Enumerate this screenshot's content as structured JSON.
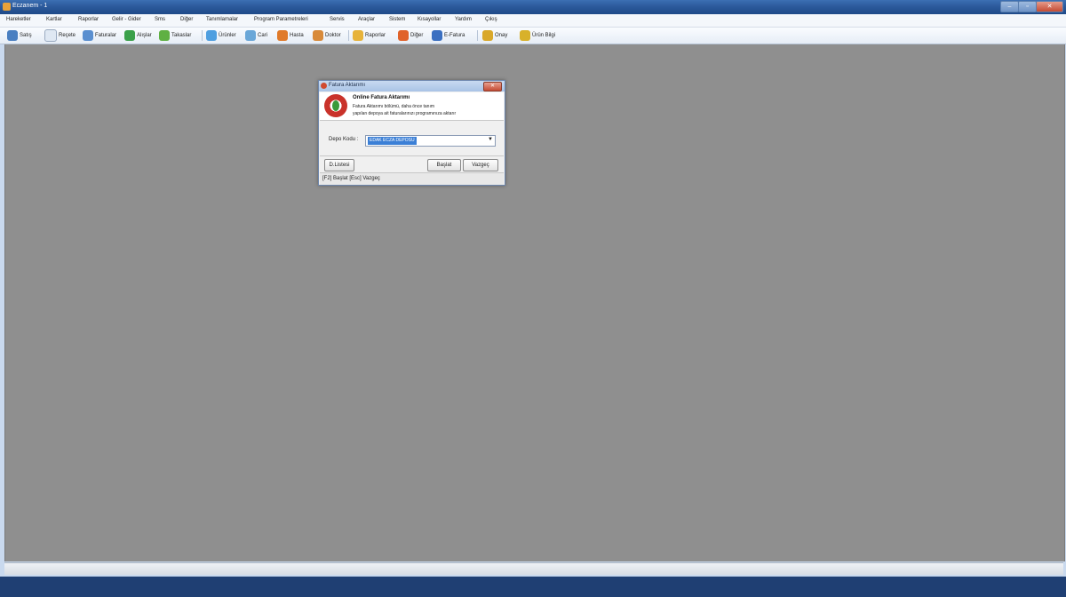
{
  "window": {
    "title": "Eczanem - 1"
  },
  "menu": [
    "Hareketler",
    "Kartlar",
    "Raporlar",
    "Gelir - Gider",
    "Sms",
    "Diğer",
    "Tanımlamalar",
    "Program Parametreleri",
    "Servis",
    "Araçlar",
    "Sistem",
    "Kısayollar",
    "Yardım",
    "Çıkış"
  ],
  "toolbar": [
    {
      "label": "Satış",
      "icon": "cart-icon",
      "color": "#4a7fc1"
    },
    {
      "label": "Reçete",
      "icon": "document-icon",
      "color": "#dfe8f3"
    },
    {
      "label": "Faturalar",
      "icon": "truck-icon",
      "color": "#5a8fd0"
    },
    {
      "label": "Alışlar",
      "icon": "shield-check-icon",
      "color": "#3aa04a"
    },
    {
      "label": "Takaslar",
      "icon": "swap-arrows-icon",
      "color": "#5fb043"
    },
    {
      "label": "Ürünler",
      "icon": "flask-icon",
      "color": "#4f9fe0"
    },
    {
      "label": "Cari",
      "icon": "people-icon",
      "color": "#6aa7d8"
    },
    {
      "label": "Hasta",
      "icon": "patient-icon",
      "color": "#e07a2a"
    },
    {
      "label": "Doktor",
      "icon": "doctor-icon",
      "color": "#d88a3a"
    },
    {
      "label": "Raporlar",
      "icon": "report-icon",
      "color": "#e7b33a"
    },
    {
      "label": "Diğer",
      "icon": "signpost-icon",
      "color": "#e0622a"
    },
    {
      "label": "E-Fatura",
      "icon": "network-icon",
      "color": "#3a6fc1"
    },
    {
      "label": "Onay",
      "icon": "approve-icon",
      "color": "#d9a82a"
    },
    {
      "label": "Ürün Bilgi",
      "icon": "info-check-icon",
      "color": "#d8b12a"
    }
  ],
  "dialog": {
    "title": "Fatura Aktarımı",
    "heading": "Online Fatura Aktarımı",
    "desc1": "Fatura Aktarımı bölümü, daha önce tanım",
    "desc2": "yapılan depoya ait faturalarınızı programınıza aktarır",
    "depo_label": "Depo Kodu :",
    "depo_value": "EDAK ECZA DEPOSU",
    "btn_liste": "D.Listesi",
    "btn_baslat": "Başlat",
    "btn_vazgec": "Vazgeç",
    "status": "[F2] Başlat  [Esc] Vazgeç"
  }
}
